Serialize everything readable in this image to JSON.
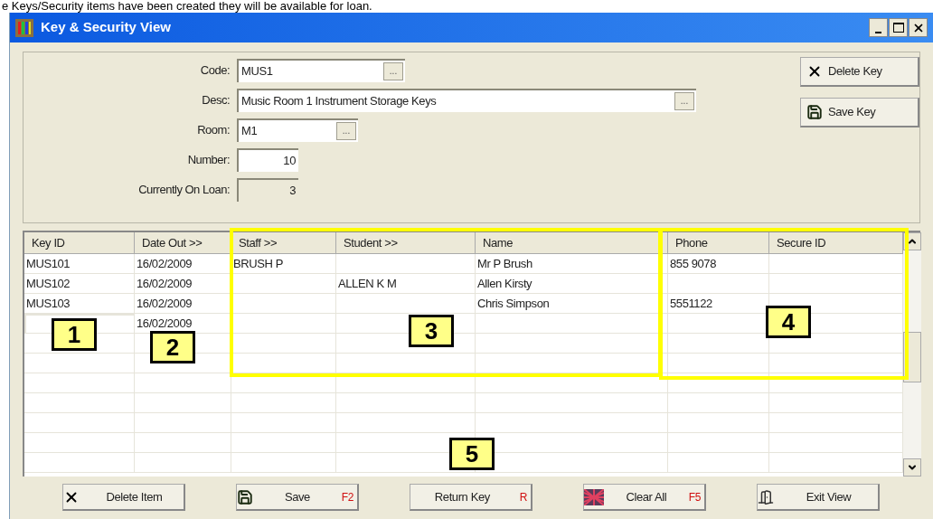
{
  "doc_text": "e Keys/Security items have been created they will be available for loan.",
  "window": {
    "title": "Key & Security View"
  },
  "form": {
    "fields": [
      {
        "label": "Code:",
        "value": "MUS1",
        "kind": "lookup",
        "disabled": false
      },
      {
        "label": "Desc:",
        "value": "Music Room 1 Instrument Storage Keys",
        "kind": "lookup",
        "disabled": false
      },
      {
        "label": "Room:",
        "value": "M1",
        "kind": "lookup",
        "disabled": false
      },
      {
        "label": "Number:",
        "value": "10",
        "kind": "number",
        "disabled": false
      },
      {
        "label": "Currently On Loan:",
        "value": "3",
        "kind": "number",
        "disabled": true
      }
    ],
    "lookup_button": "...",
    "buttons": [
      {
        "label": "Delete Key",
        "kind": "delete"
      },
      {
        "label": "Save Key",
        "kind": "save"
      }
    ]
  },
  "table": {
    "columns": [
      "Key ID",
      "Date Out >>",
      "Staff >>",
      "Student >>",
      "Name",
      "Phone",
      "Secure ID"
    ],
    "rows": [
      {
        "cells": [
          "MUS101",
          "16/02/2009",
          "BRUSH P",
          "",
          "Mr P Brush",
          "855 9078",
          ""
        ],
        "editing": false
      },
      {
        "cells": [
          "MUS102",
          "16/02/2009",
          "",
          "ALLEN K M",
          "Allen Kirsty",
          "",
          ""
        ],
        "editing": false
      },
      {
        "cells": [
          "MUS103",
          "16/02/2009",
          "",
          "",
          "Chris Simpson",
          "5551122",
          ""
        ],
        "editing": false
      },
      {
        "cells": [
          "",
          "16/02/2009",
          "",
          "",
          "",
          "",
          ""
        ],
        "editing": true
      }
    ]
  },
  "buttons": [
    {
      "label": "Delete Item",
      "kind": "delete"
    },
    {
      "label": "Save",
      "kind": "save",
      "shortcut": "F2"
    },
    {
      "label": "Return Key",
      "kind": "none",
      "shortcut": "R"
    },
    {
      "label": "Clear All",
      "kind": "clear",
      "shortcut": "F5"
    },
    {
      "label": "Exit View",
      "kind": "exit"
    }
  ],
  "annotations": [
    {
      "label": "1"
    },
    {
      "label": "2"
    },
    {
      "label": "3"
    },
    {
      "label": "4"
    },
    {
      "label": "5"
    }
  ]
}
